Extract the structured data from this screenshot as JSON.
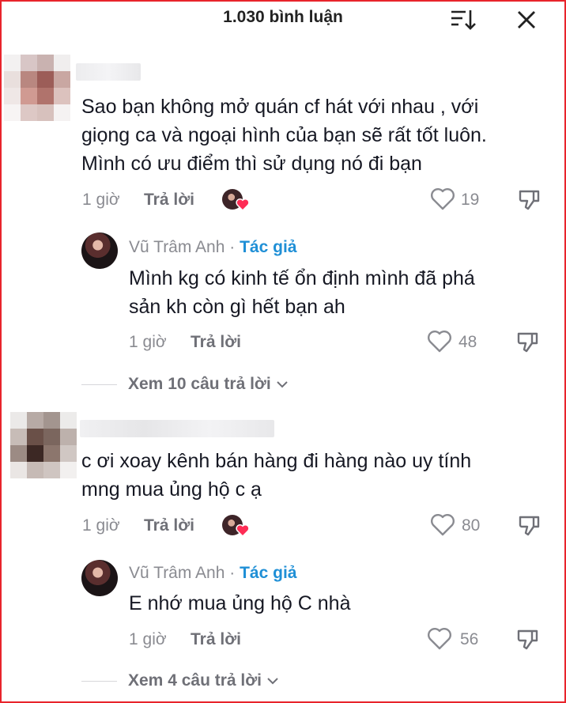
{
  "header": {
    "title": "1.030 bình luận"
  },
  "comments": [
    {
      "text_lines": [
        "Sao bạn không mở quán cf hát với nhau , với",
        "giọng ca và ngoại hình của bạn sẽ rất tốt luôn.",
        "Mình có ưu điểm thì sử dụng nó đi bạn"
      ],
      "time": "1 giờ",
      "reply_label": "Trả lời",
      "likes": "19",
      "reply": {
        "author": "Vũ Trâm Anh",
        "separator": "·",
        "tag": "Tác giả",
        "text_lines": [
          "Mình kg có kinh tế ổn định mình đã phá",
          "sản kh còn gì hết bạn ah"
        ],
        "time": "1 giờ",
        "reply_label": "Trả lời",
        "likes": "48"
      },
      "view_more": "Xem 10 câu trả lời"
    },
    {
      "text_lines": [
        "c ơi xoay kênh bán hàng đi hàng nào uy tính",
        "mng mua ủng hộ c ạ"
      ],
      "time": "1 giờ",
      "reply_label": "Trả lời",
      "likes": "80",
      "reply": {
        "author": "Vũ Trâm Anh",
        "separator": "·",
        "tag": "Tác giả",
        "text_lines": [
          "E nhớ mua ủng hộ C nhà"
        ],
        "time": "1 giờ",
        "reply_label": "Trả lời",
        "likes": "56"
      },
      "view_more": "Xem 4 câu trả lời"
    }
  ],
  "icons": {
    "sort": "sort-icon",
    "close": "close-icon",
    "like": "heart-outline-icon",
    "dislike": "thumbs-down-icon",
    "creator_liked": "heart-badge-icon",
    "expand": "chevron-down-icon"
  },
  "colors": {
    "frame": "#e8242b",
    "author_tag": "#1f8fd6",
    "heart_badge": "#fe2c55"
  }
}
